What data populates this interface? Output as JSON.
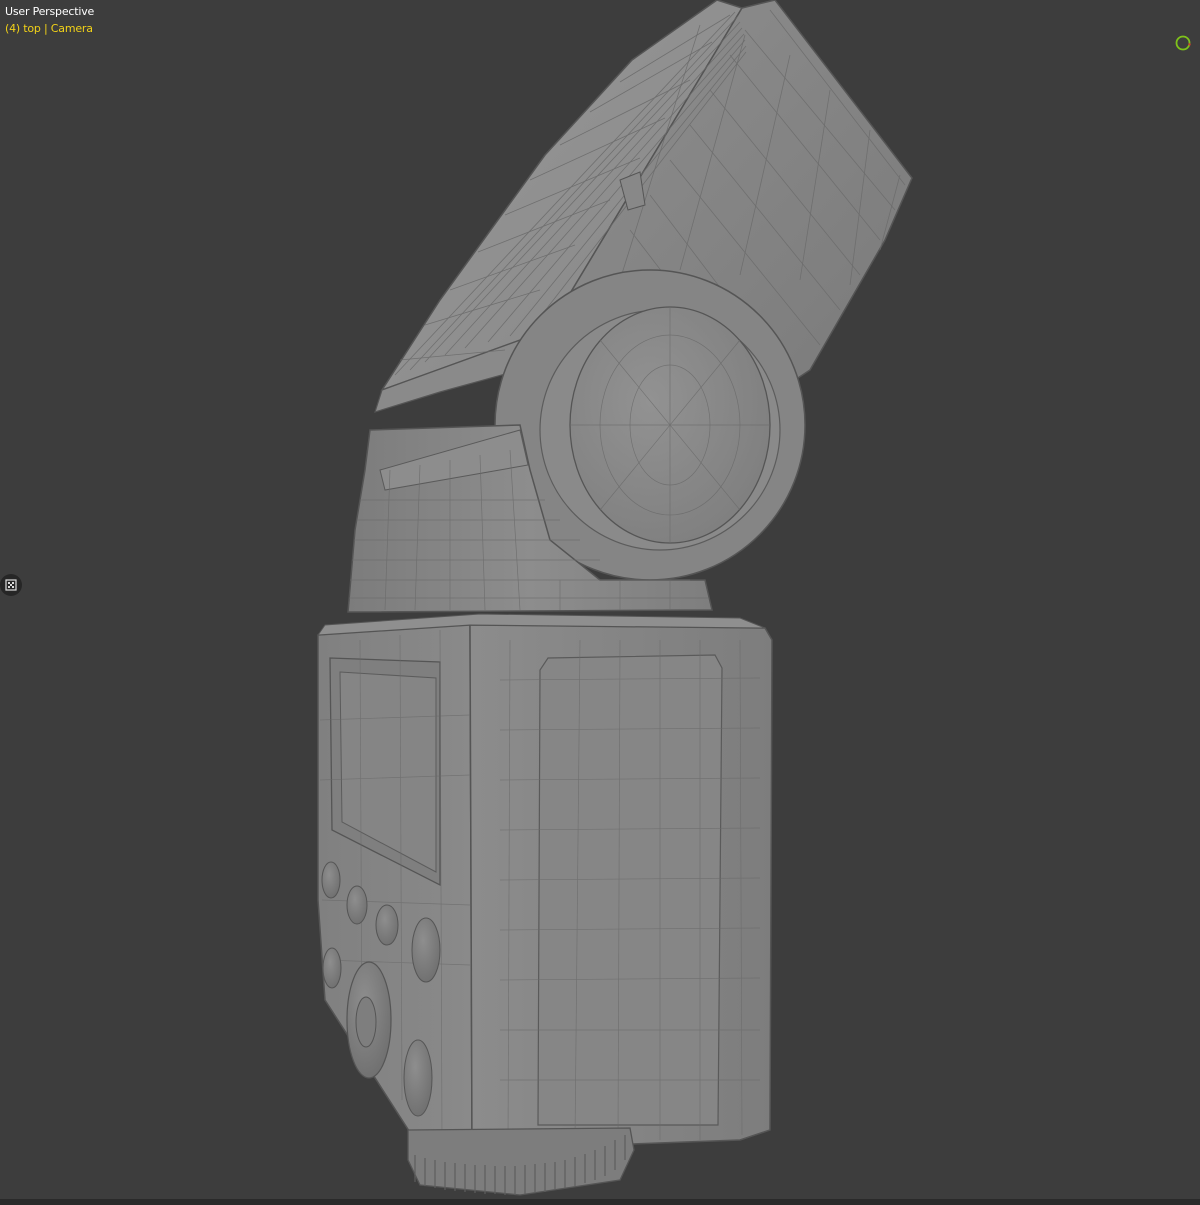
{
  "viewport": {
    "view_name": "User Perspective",
    "object_info": "(4) top | Camera",
    "background_color": "#3d3d3d",
    "model_color": "#8c8c8c",
    "wire_color": "#5f5f5f"
  },
  "icons": {
    "navigation_gizmo": "navigation-gizmo-icon",
    "sidebar_toggle": "sidebar-toggle-icon"
  }
}
